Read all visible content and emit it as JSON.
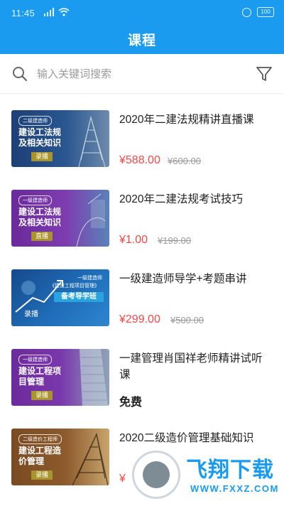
{
  "status": {
    "time": "11:45",
    "battery": "100"
  },
  "header": {
    "title": "课程"
  },
  "search": {
    "placeholder": "输入关键词搜索"
  },
  "courses": [
    {
      "title": "2020年二建法规精讲直播课",
      "price": "¥588.00",
      "original_price": "¥600.00",
      "thumb": {
        "tag": "二级建造师",
        "title": "建设工法规及相关知识",
        "badge": "录播"
      }
    },
    {
      "title": "2020年二建法规考试技巧",
      "price": "¥1.00",
      "original_price": "¥199.00",
      "thumb": {
        "tag": "一级建造师",
        "title": "建设工法规及相关知识",
        "badge": "直播"
      }
    },
    {
      "title": "一级建造师导学+考题串讲",
      "price": "¥299.00",
      "original_price": "¥500.00",
      "thumb": {
        "tag": "一级建造师",
        "title": "《建设工程项目管理》",
        "badge": "录播",
        "banner": "备考导学班"
      }
    },
    {
      "title": "一建管理肖国祥老师精讲试听课",
      "free_label": "免费",
      "thumb": {
        "tag": "一级建造师",
        "title": "建设工程项目管理",
        "badge": "录播"
      }
    },
    {
      "title": "2020二级造价管理基础知识",
      "price": "¥",
      "thumb": {
        "tag": "二级造价工程师",
        "title": "建设工程造价管理",
        "badge": "录播"
      }
    }
  ],
  "watermark": {
    "text": "飞翔下载",
    "url": "WWW.FXXZ.COM"
  },
  "colors": {
    "brand": "#1a9bf0",
    "price": "#f04a4a"
  }
}
